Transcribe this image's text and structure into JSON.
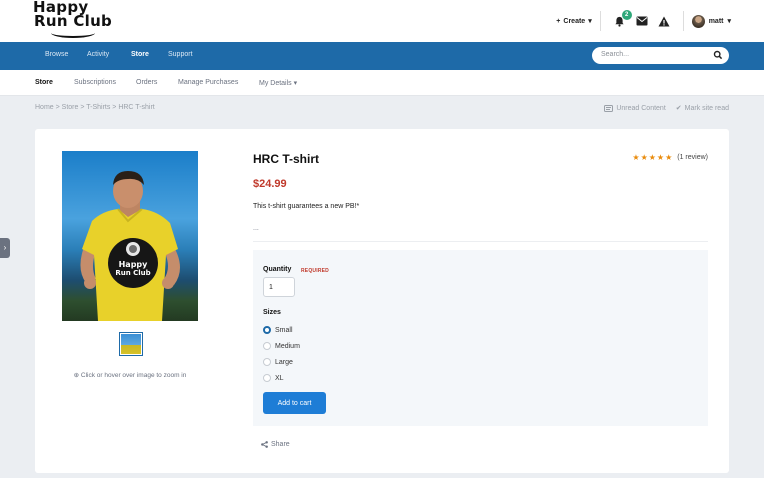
{
  "logo": {
    "line1": "Happy",
    "line2": "Run Club"
  },
  "header": {
    "create_label": "Create",
    "notification_count": "2",
    "username": "matt"
  },
  "nav": {
    "items": [
      "Browse",
      "Activity",
      "Store",
      "Support"
    ],
    "active": "Store",
    "search_placeholder": "Search..."
  },
  "subnav": {
    "items": [
      "Store",
      "Subscriptions",
      "Orders",
      "Manage Purchases",
      "My Details"
    ],
    "active": "Store"
  },
  "breadcrumb": {
    "text": "Home > Store > T-Shirts > HRC T-shirt",
    "unread_label": "Unread Content",
    "mark_read_label": "Mark site read"
  },
  "product": {
    "title": "HRC T-shirt",
    "rating_stars": 5,
    "review_text": "(1 review)",
    "price": "$24.99",
    "description": "This t-shirt guarantees a new PB!*",
    "more": "...",
    "shirt_logo_line1": "Happy",
    "shirt_logo_line2": "Run Club",
    "zoom_hint": "Click or hover over image to zoom in"
  },
  "options": {
    "quantity_label": "Quantity",
    "required_label": "REQUIRED",
    "quantity_value": "1",
    "sizes_label": "Sizes",
    "sizes": [
      "Small",
      "Medium",
      "Large",
      "XL"
    ],
    "selected_size": "Small",
    "add_to_cart": "Add to cart"
  },
  "share_label": "Share",
  "colors": {
    "brand_blue": "#1e6aa8",
    "button_blue": "#1e7dd6",
    "price_red": "#c0392b",
    "star_orange": "#e98b0c",
    "badge_green": "#2fa87a"
  }
}
